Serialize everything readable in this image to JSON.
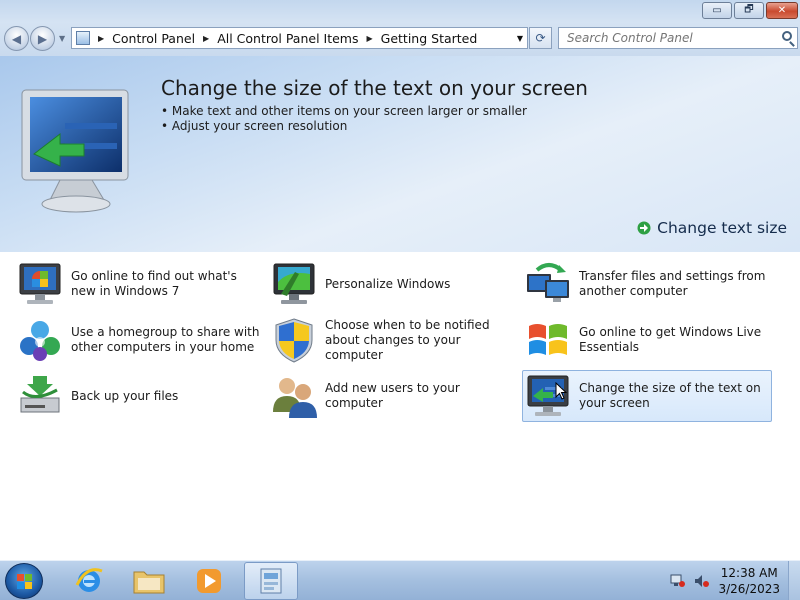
{
  "window": {
    "caption": {
      "minimize": "▭",
      "maximize": "🗗",
      "close": "✕"
    }
  },
  "nav": {
    "back_glyph": "◀",
    "forward_glyph": "▶",
    "breadcrumb": [
      "Control Panel",
      "All Control Panel Items",
      "Getting Started"
    ],
    "refresh_glyph": "⟳",
    "search": {
      "placeholder": "Search Control Panel",
      "value": ""
    }
  },
  "hero": {
    "title": "Change the size of the text on your screen",
    "bullets": [
      "Make text and other items on your screen larger or smaller",
      "Adjust your screen resolution"
    ],
    "action_label": "Change text size"
  },
  "tasks": [
    {
      "label": "Go online to find out what's new in Windows 7",
      "icon": "windows-monitor-icon"
    },
    {
      "label": "Personalize Windows",
      "icon": "personalize-monitor-icon"
    },
    {
      "label": "Transfer files and settings from another computer",
      "icon": "transfer-computers-icon"
    },
    {
      "label": "Use a homegroup to share with other computers in your home",
      "icon": "homegroup-icon"
    },
    {
      "label": "Choose when to be notified about changes to your computer",
      "icon": "uac-shield-icon"
    },
    {
      "label": "Go online to get Windows Live Essentials",
      "icon": "windows-flag-icon"
    },
    {
      "label": "Back up your files",
      "icon": "backup-drive-icon"
    },
    {
      "label": "Add new users to your computer",
      "icon": "users-icon"
    },
    {
      "label": "Change the size of the text on your screen",
      "icon": "text-size-monitor-icon",
      "selected": true
    }
  ],
  "taskbar": {
    "items": [
      "internet-explorer-icon",
      "windows-explorer-icon",
      "media-player-icon",
      "control-panel-icon"
    ],
    "active": "control-panel-icon",
    "tray_icons": [
      "network-icon",
      "volume-muted-icon"
    ],
    "time": "12:38 AM",
    "date": "3/26/2023"
  },
  "colors": {
    "hero_gradient_start": "#a9c8ec",
    "selected_task_border": "#8fb3df",
    "taskbar": "#a4bfdf",
    "accent_green": "#2ea043"
  }
}
